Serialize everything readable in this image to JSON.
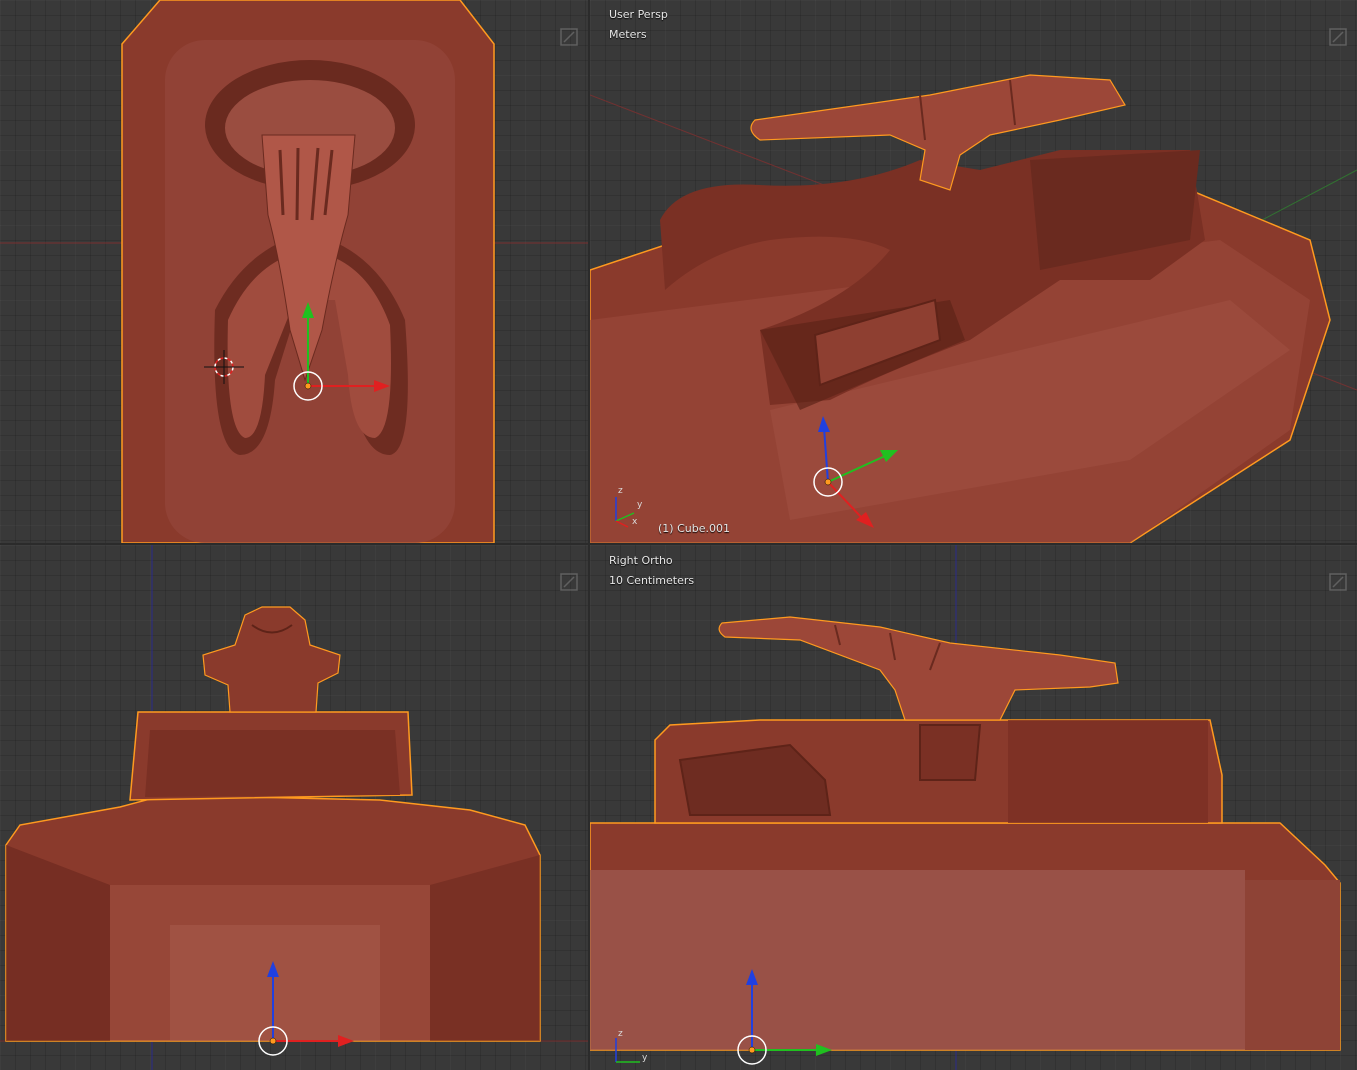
{
  "viewports": {
    "top": {
      "name": "",
      "units": ""
    },
    "perspective": {
      "name": "User Persp",
      "units": "Meters",
      "object_label": "(1) Cube.001",
      "axis_labels": {
        "x": "x",
        "y": "y",
        "z": "z"
      }
    },
    "front": {
      "name": "",
      "units": ""
    },
    "right": {
      "name": "Right Ortho",
      "units": "10 Centimeters",
      "axis_labels": {
        "y": "y",
        "z": "z"
      }
    }
  },
  "icons": {
    "maximize": "maximize-icon",
    "cursor": "3d-cursor-icon",
    "manipulator": "transform-manipulator-icon"
  },
  "colors": {
    "viewport_bg": "#393939",
    "mesh": "#8a3a2c",
    "mesh_light": "#a14a3a",
    "mesh_dark": "#5e2318",
    "selection_outline": "#ff9a1f",
    "axis_x": "#e02020",
    "axis_y": "#20c020",
    "axis_z": "#2040e0"
  }
}
